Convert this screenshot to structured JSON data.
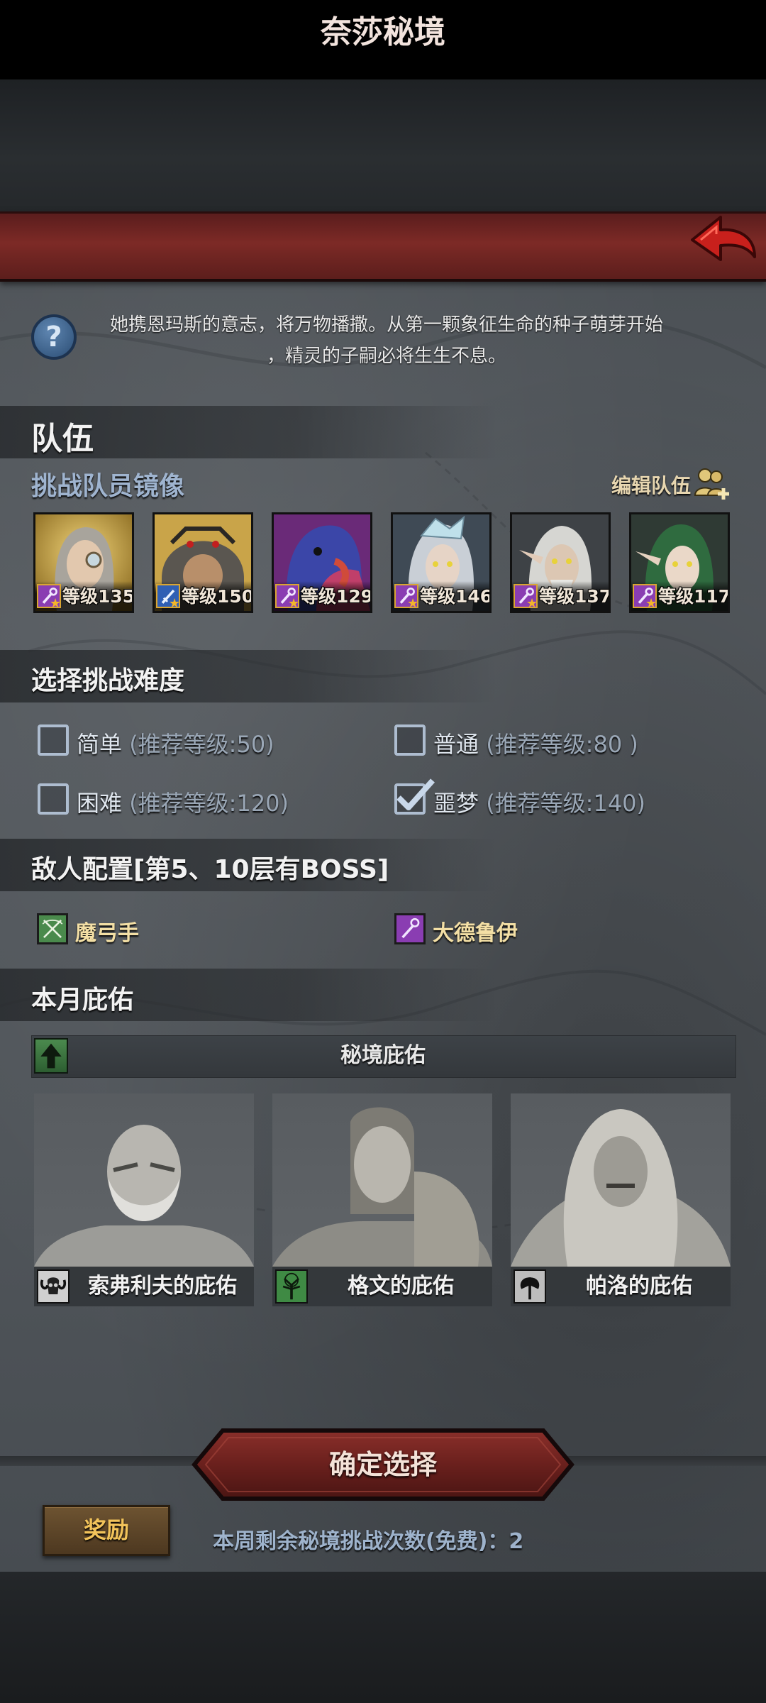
{
  "header": {
    "title": "奈莎秘境"
  },
  "description": {
    "line1": "她携恩玛斯的意志，将万物播撒。从第一颗象征生命的种子萌芽开始",
    "line2": "，精灵的子嗣必将生生不息。"
  },
  "team": {
    "title": "队伍",
    "subtitle": "挑战队员镜像",
    "edit_label": "编辑队伍",
    "heroes": [
      {
        "level": "等级135",
        "class_icon": "staff-icon"
      },
      {
        "level": "等级150",
        "class_icon": "sword-icon"
      },
      {
        "level": "等级129",
        "class_icon": "staff-icon"
      },
      {
        "level": "等级146",
        "class_icon": "staff-icon"
      },
      {
        "level": "等级137",
        "class_icon": "staff-icon"
      },
      {
        "level": "等级117",
        "class_icon": "staff-icon"
      }
    ]
  },
  "difficulty": {
    "title": "选择挑战难度",
    "options": [
      {
        "name": "简单",
        "rec": "(推荐等级:50)",
        "checked": false
      },
      {
        "name": "普通",
        "rec": "(推荐等级:80 )",
        "checked": false
      },
      {
        "name": "困难",
        "rec": "(推荐等级:120)",
        "checked": false
      },
      {
        "name": "噩梦",
        "rec": "(推荐等级:140)",
        "checked": true
      }
    ]
  },
  "enemy": {
    "title": "敌人配置[第5、10层有BOSS]",
    "types": [
      {
        "label": "魔弓手",
        "icon": "bow-icon"
      },
      {
        "label": "大德鲁伊",
        "icon": "staff-icon"
      }
    ]
  },
  "blessing": {
    "title": "本月庇佑",
    "bar_label": "秘境庇佑",
    "cards": [
      {
        "label": "索弗利夫的庇佑",
        "icon": "ram-skull-icon"
      },
      {
        "label": "格文的庇佑",
        "icon": "tree-icon"
      },
      {
        "label": "帕洛的庇佑",
        "icon": "axe-icon"
      }
    ]
  },
  "footer": {
    "confirm_label": "确定选择",
    "reward_label": "奖励",
    "remaining_text": "本周剩余秘境挑战次数(免费)：2"
  },
  "colors": {
    "title_red": "#7d2a26",
    "accent_gold": "#f2c35a",
    "label_blue": "#9fb4cf",
    "checkbox_border": "#aebdd0"
  }
}
